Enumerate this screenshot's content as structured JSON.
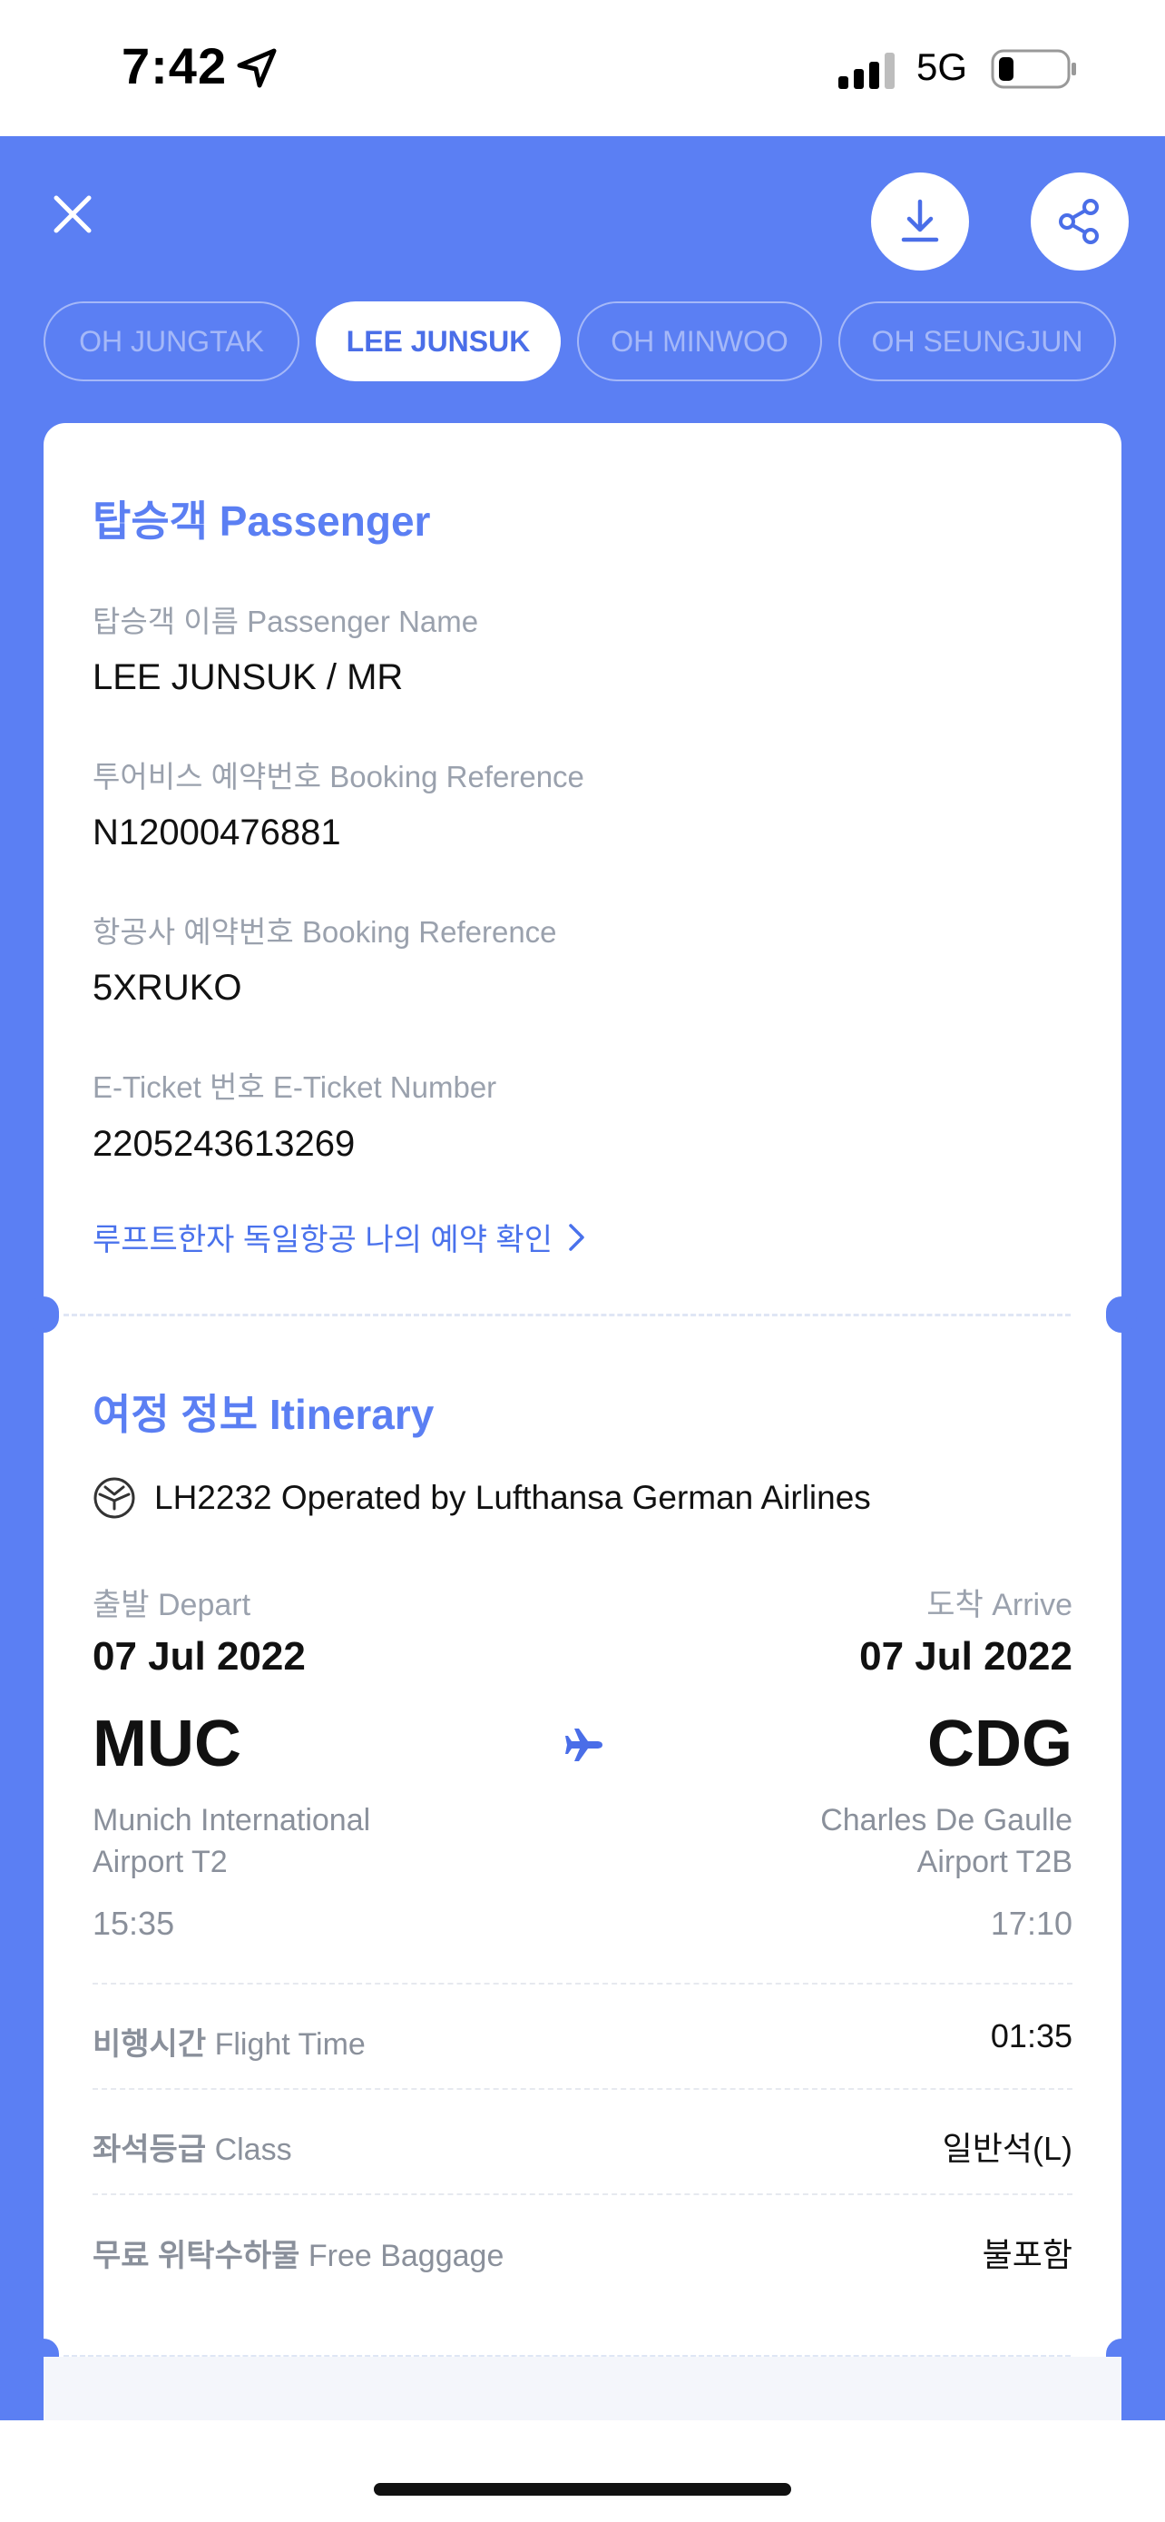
{
  "status_bar": {
    "time": "7:42",
    "network": "5G",
    "location_icon": "location-arrow-icon",
    "signal_icon": "cellular-signal-icon",
    "battery_icon": "battery-low-icon"
  },
  "header": {
    "close_icon": "close-icon",
    "download_icon": "download-icon",
    "share_icon": "share-icon"
  },
  "passenger_tabs": [
    {
      "label": "OH JUNGTAK",
      "active": false
    },
    {
      "label": "LEE JUNSUK",
      "active": true
    },
    {
      "label": "OH MINWOO",
      "active": false
    },
    {
      "label": "OH SEUNGJUN",
      "active": false
    }
  ],
  "passenger_section": {
    "title": "탑승객 Passenger",
    "name_label": "탑승객 이름 Passenger Name",
    "name_value": "LEE JUNSUK / MR",
    "tourvis_ref_label": "투어비스 예약번호 Booking Reference",
    "tourvis_ref_value": "N12000476881",
    "airline_ref_label": "항공사 예약번호 Booking Reference",
    "airline_ref_value": "5XRUKO",
    "eticket_label": "E-Ticket 번호 E-Ticket Number",
    "eticket_value": "2205243613269",
    "airline_link": "루프트한자 독일항공 나의 예약 확인"
  },
  "itinerary": {
    "title": "여정 정보 Itinerary",
    "flight_line": "LH2232 Operated by Lufthansa German Airlines",
    "depart_label": "출발 Depart",
    "arrive_label": "도착 Arrive",
    "depart_date": "07 Jul 2022",
    "arrive_date": "07 Jul 2022",
    "depart_code": "MUC",
    "arrive_code": "CDG",
    "depart_airport_line1": "Munich International",
    "depart_airport_line2": "Airport T2",
    "arrive_airport_line1": "Charles De Gaulle",
    "arrive_airport_line2": "Airport T2B",
    "depart_time": "15:35",
    "arrive_time": "17:10",
    "flight_time_label_ko": "비행시간",
    "flight_time_label_en": "Flight Time",
    "flight_time_value": "01:35",
    "class_label_ko": "좌석등급",
    "class_label_en": "Class",
    "class_value": "일반석(L)",
    "baggage_label_ko": "무료 위탁수하물",
    "baggage_label_en": "Free Baggage",
    "baggage_value": "불포함"
  },
  "colors": {
    "brand_blue": "#5b7ff3",
    "link_blue": "#4a72ec"
  }
}
